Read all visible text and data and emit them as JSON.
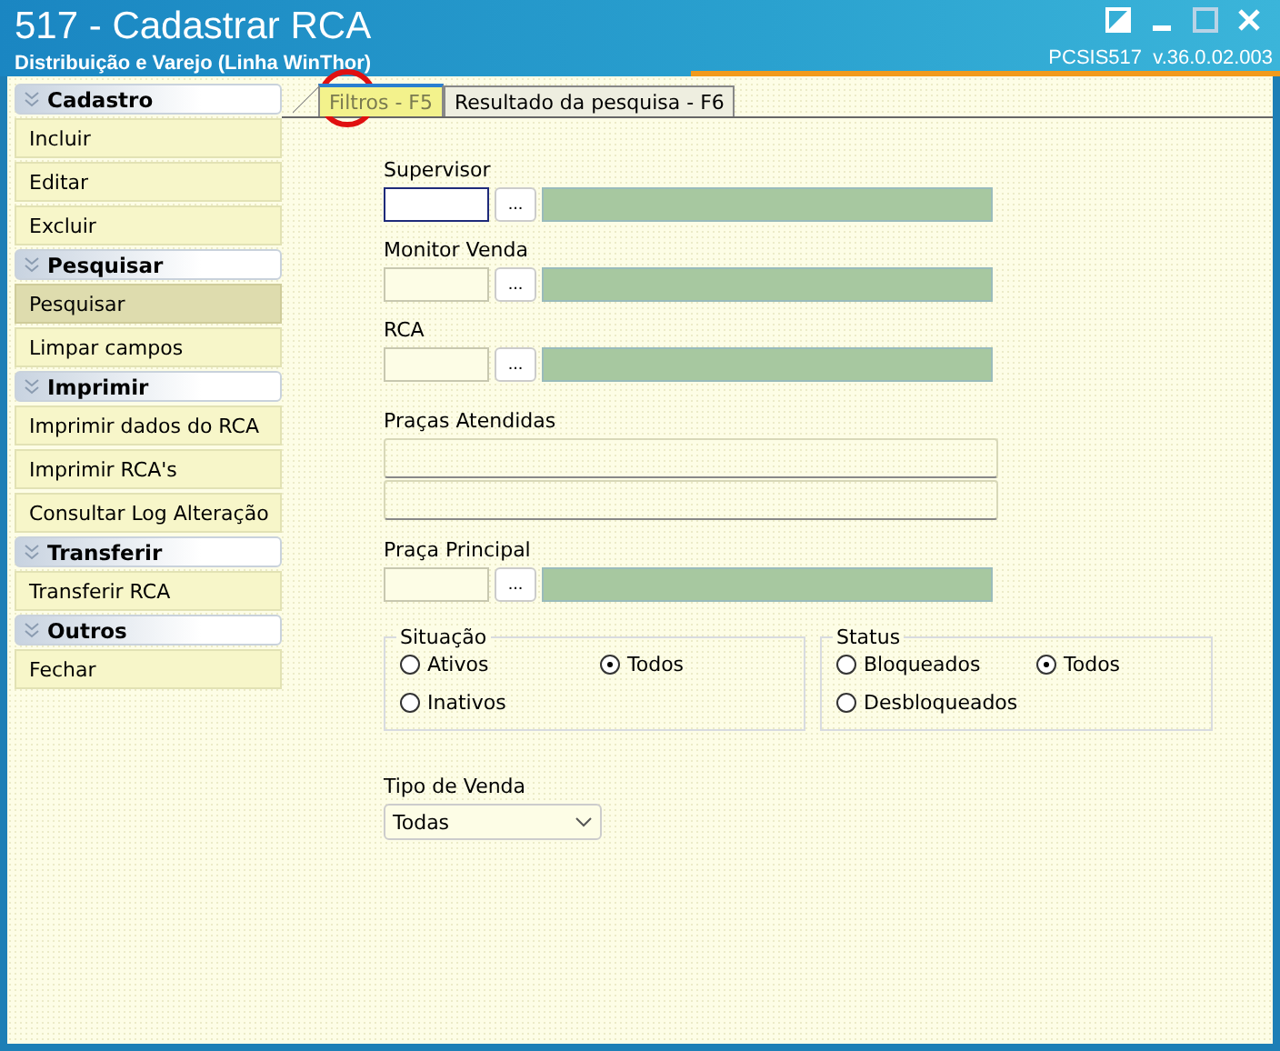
{
  "window": {
    "title": "517 - Cadastrar RCA",
    "subtitle": "Distribuição e Varejo (Linha WinThor)",
    "version": "PCSIS517  v.36.0.02.003"
  },
  "sidebar": {
    "groups": [
      {
        "title": "Cadastro",
        "items": [
          {
            "label": "Incluir",
            "selected": false
          },
          {
            "label": "Editar",
            "selected": false
          },
          {
            "label": "Excluir",
            "selected": false
          }
        ]
      },
      {
        "title": "Pesquisar",
        "items": [
          {
            "label": "Pesquisar",
            "selected": true
          },
          {
            "label": "Limpar campos",
            "selected": false
          }
        ]
      },
      {
        "title": "Imprimir",
        "items": [
          {
            "label": "Imprimir dados do RCA",
            "selected": false
          },
          {
            "label": "Imprimir RCA's",
            "selected": false
          },
          {
            "label": "Consultar Log Alteração",
            "selected": false
          }
        ]
      },
      {
        "title": "Transferir",
        "items": [
          {
            "label": "Transferir RCA",
            "selected": false
          }
        ]
      },
      {
        "title": "Outros",
        "items": [
          {
            "label": "Fechar",
            "selected": false
          }
        ]
      }
    ]
  },
  "tabs": [
    {
      "label": "Filtros - F5",
      "selected": true,
      "highlighted": true
    },
    {
      "label": "Resultado da pesquisa - F6",
      "selected": false,
      "highlighted": false
    }
  ],
  "fields": [
    {
      "kind": "lookup",
      "label": "Supervisor",
      "button": "...",
      "focused": true
    },
    {
      "kind": "lookup",
      "label": "Monitor Venda",
      "button": "...",
      "focused": false
    },
    {
      "kind": "lookup",
      "label": "RCA",
      "button": "...",
      "focused": false
    },
    {
      "kind": "list",
      "label": "Praças Atendidas"
    },
    {
      "kind": "lookup",
      "label": "Praça Principal",
      "button": "...",
      "focused": false
    }
  ],
  "radio_groups": [
    {
      "title": "Situação",
      "options": [
        {
          "label": "Ativos",
          "selected": false
        },
        {
          "label": "Todos",
          "selected": true
        },
        {
          "label": "Inativos",
          "selected": false
        }
      ]
    },
    {
      "title": "Status",
      "options": [
        {
          "label": "Bloqueados",
          "selected": false
        },
        {
          "label": "Todos",
          "selected": true
        },
        {
          "label": "Desbloqueados",
          "selected": false
        }
      ]
    }
  ],
  "dropdown": {
    "label": "Tipo de Venda",
    "value": "Todas"
  }
}
